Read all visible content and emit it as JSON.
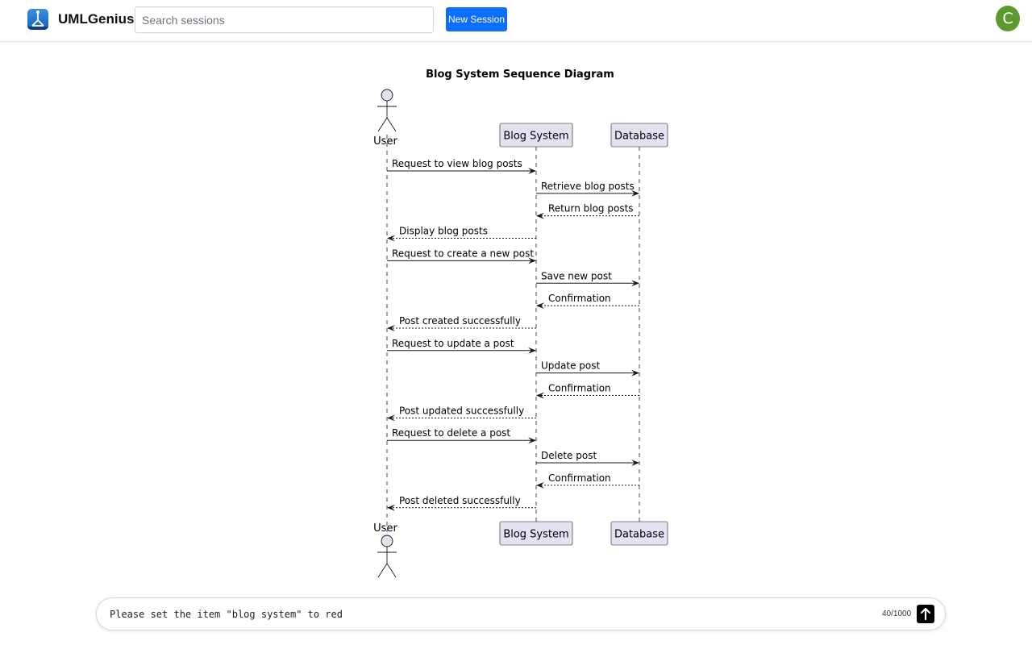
{
  "header": {
    "app_name": "UMLGenius",
    "search_placeholder": "Search sessions",
    "new_session_label": "New Session",
    "avatar_initial": "C"
  },
  "diagram": {
    "title": "Blog System Sequence Diagram",
    "participants": [
      {
        "name": "User",
        "kind": "actor"
      },
      {
        "name": "Blog System",
        "kind": "participant"
      },
      {
        "name": "Database",
        "kind": "participant"
      }
    ],
    "messages": [
      {
        "from": "User",
        "to": "Blog System",
        "label": "Request to view blog posts",
        "style": "sync"
      },
      {
        "from": "Blog System",
        "to": "Database",
        "label": "Retrieve blog posts",
        "style": "sync"
      },
      {
        "from": "Database",
        "to": "Blog System",
        "label": "Return blog posts",
        "style": "reply"
      },
      {
        "from": "Blog System",
        "to": "User",
        "label": "Display blog posts",
        "style": "reply"
      },
      {
        "from": "User",
        "to": "Blog System",
        "label": "Request to create a new post",
        "style": "sync"
      },
      {
        "from": "Blog System",
        "to": "Database",
        "label": "Save new post",
        "style": "sync"
      },
      {
        "from": "Database",
        "to": "Blog System",
        "label": "Confirmation",
        "style": "reply"
      },
      {
        "from": "Blog System",
        "to": "User",
        "label": "Post created successfully",
        "style": "reply"
      },
      {
        "from": "User",
        "to": "Blog System",
        "label": "Request to update a post",
        "style": "sync"
      },
      {
        "from": "Blog System",
        "to": "Database",
        "label": "Update post",
        "style": "sync"
      },
      {
        "from": "Database",
        "to": "Blog System",
        "label": "Confirmation",
        "style": "reply"
      },
      {
        "from": "Blog System",
        "to": "User",
        "label": "Post updated successfully",
        "style": "reply"
      },
      {
        "from": "User",
        "to": "Blog System",
        "label": "Request to delete a post",
        "style": "sync"
      },
      {
        "from": "Blog System",
        "to": "Database",
        "label": "Delete post",
        "style": "sync"
      },
      {
        "from": "Database",
        "to": "Blog System",
        "label": "Confirmation",
        "style": "reply"
      },
      {
        "from": "Blog System",
        "to": "User",
        "label": "Post deleted successfully",
        "style": "reply"
      }
    ],
    "colors": {
      "participant_fill": "#e2e2f0",
      "participant_border": "#181818",
      "lifeline": "#181818",
      "arrow": "#181818"
    }
  },
  "chat": {
    "input_value": "Please set the item \"blog system\" to red",
    "counter": "40/1000"
  },
  "colors": {
    "accent": "#0d6efd",
    "avatar": "#5b9a2f"
  }
}
